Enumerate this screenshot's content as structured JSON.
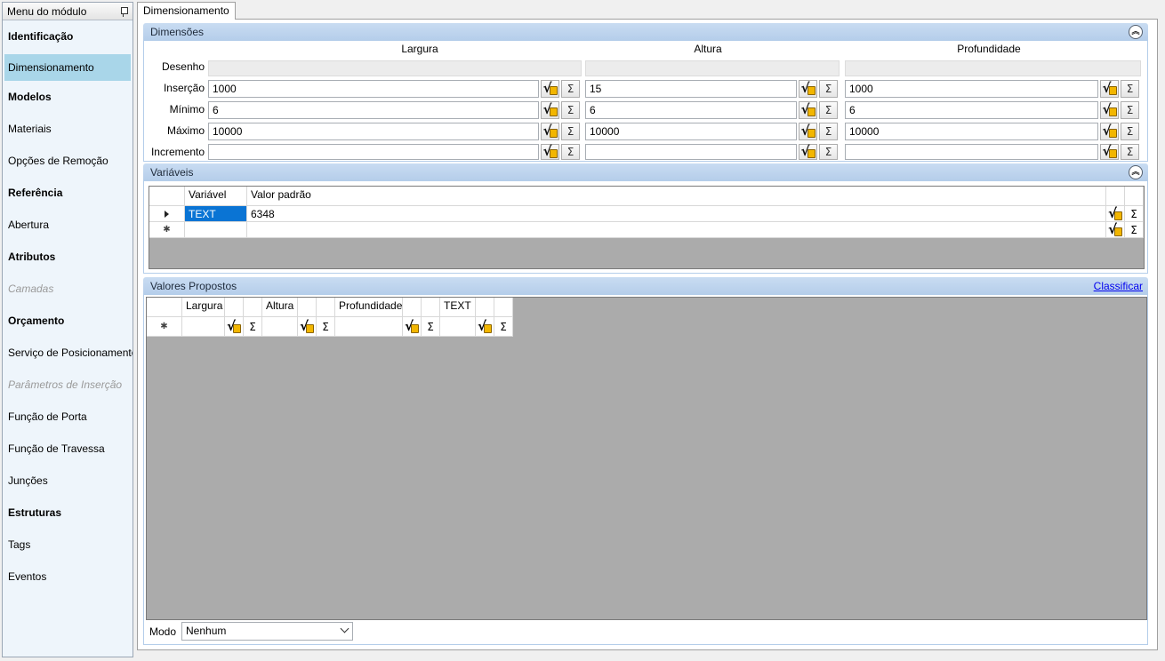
{
  "sidebar": {
    "title": "Menu do módulo",
    "items": [
      {
        "label": "Identificação",
        "style": "bold"
      },
      {
        "label": "Dimensionamento",
        "style": "selected"
      },
      {
        "label": "Modelos",
        "style": "bold"
      },
      {
        "label": "Materiais",
        "style": "normal"
      },
      {
        "label": "Opções de Remoção",
        "style": "normal"
      },
      {
        "label": "Referência",
        "style": "bold"
      },
      {
        "label": "Abertura",
        "style": "normal"
      },
      {
        "label": "Atributos",
        "style": "bold"
      },
      {
        "label": "Camadas",
        "style": "disabled"
      },
      {
        "label": "Orçamento",
        "style": "bold"
      },
      {
        "label": "Serviço de Posicionamento",
        "style": "normal"
      },
      {
        "label": "Parâmetros de Inserção",
        "style": "disabled"
      },
      {
        "label": "Função de Porta",
        "style": "normal"
      },
      {
        "label": "Função de Travessa",
        "style": "normal"
      },
      {
        "label": "Junções",
        "style": "normal"
      },
      {
        "label": "Estruturas",
        "style": "bold"
      },
      {
        "label": "Tags",
        "style": "normal"
      },
      {
        "label": "Eventos",
        "style": "normal"
      }
    ]
  },
  "tab": {
    "label": "Dimensionamento"
  },
  "dimensoes": {
    "title": "Dimensões",
    "columns": [
      "Largura",
      "Altura",
      "Profundidade"
    ],
    "rows": [
      {
        "label": "Desenho",
        "values": [
          "",
          "",
          ""
        ]
      },
      {
        "label": "Inserção",
        "values": [
          "1000",
          "15",
          "1000"
        ]
      },
      {
        "label": "Mínimo",
        "values": [
          "6",
          "6",
          "6"
        ]
      },
      {
        "label": "Máximo",
        "values": [
          "10000",
          "10000",
          "10000"
        ]
      },
      {
        "label": "Incremento",
        "values": [
          "",
          "",
          ""
        ]
      }
    ]
  },
  "variaveis": {
    "title": "Variáveis",
    "headers": [
      "Variável",
      "Valor padrão"
    ],
    "rows": [
      {
        "variavel": "TEXT",
        "valor": "6348"
      }
    ]
  },
  "valores_propostos": {
    "title": "Valores Propostos",
    "link": "Classificar",
    "headers": [
      "Largura",
      "Altura",
      "Profundidade",
      "TEXT"
    ]
  },
  "modo": {
    "label": "Modo",
    "value": "Nenhum"
  },
  "icons": {
    "formula": "sqrt-formula-icon",
    "sum": "sigma-icon",
    "collapse": "double-chevron-up-icon",
    "pin": "pin-icon"
  }
}
